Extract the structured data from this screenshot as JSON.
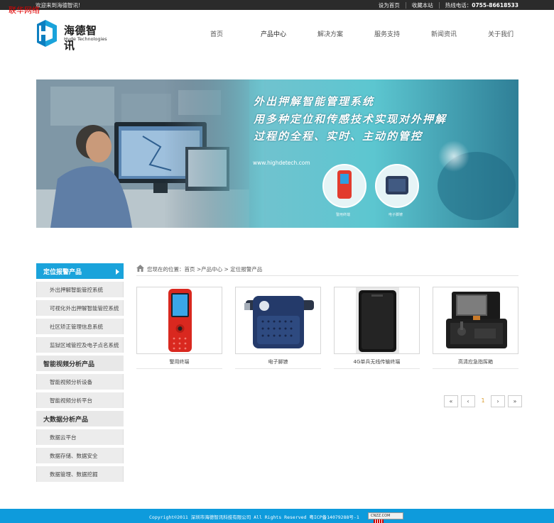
{
  "topbar": {
    "overlay_mark": "联华网络",
    "welcome": "欢迎来到海德智讯!",
    "set_home": "设为首页",
    "bookmark": "收藏本站",
    "hotline_label": "热线电话：",
    "hotline_number": "0755-86618533"
  },
  "logo": {
    "name_cn": "海德智讯",
    "name_en": "Hyde Technologies",
    "accent_color": "#1aa3db"
  },
  "nav": {
    "items": [
      {
        "label": "首页"
      },
      {
        "label": "产品中心"
      },
      {
        "label": "解决方案"
      },
      {
        "label": "服务支持"
      },
      {
        "label": "新闻资讯"
      },
      {
        "label": "关于我们"
      }
    ],
    "active_index": 1
  },
  "banner": {
    "line1": "外出押解智能管理系统",
    "line2": "用多种定位和传感技术实现对外押解",
    "line3": "过程的全程、实时、主动的管控",
    "url": "www.highdetech.com",
    "caption1": "警用终端",
    "caption2": "电子脚镣"
  },
  "sidebar": {
    "groups": [
      {
        "title": "定位报警产品",
        "items": [
          "外出押解智能管控系统",
          "可视化外出押解智能管控系统",
          "社区矫正管理信息系统",
          "监狱区域管控及电子点名系统"
        ]
      },
      {
        "title": "智能视频分析产品",
        "items": [
          "智能视频分析设备",
          "智能视频分析平台"
        ]
      },
      {
        "title": "大数据分析产品",
        "items": [
          "数据云平台",
          "数据存储、数据安全",
          "数据管理、数据挖掘"
        ]
      }
    ]
  },
  "breadcrumb": {
    "text": "您现在的位置：首页 >产品中心 > 定位报警产品"
  },
  "products": [
    {
      "name": "警用终端",
      "icon": "police-terminal"
    },
    {
      "name": "电子脚镣",
      "icon": "electronic-ankle-shackle"
    },
    {
      "name": "4G单兵无线传输终端",
      "icon": "4g-transmitter"
    },
    {
      "name": "高清应急指挥箱",
      "icon": "command-case"
    }
  ],
  "pager": {
    "first": "«",
    "prev": "‹",
    "current": "1",
    "next": "›",
    "last": "»"
  },
  "footer": {
    "text": "Copyright©2011 深圳市海德智讯科技有限公司 All Rights Reserved 粤ICP备14079288号-1",
    "badge": "CNZZ.COM"
  }
}
